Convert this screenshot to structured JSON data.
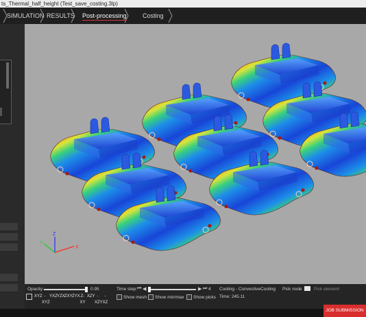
{
  "window": {
    "title": "ts_Thermal_half_height (Test_save_costing.3lp)"
  },
  "tabs": [
    {
      "label": "SIMULATION"
    },
    {
      "label": "RESULTS"
    },
    {
      "label": "Post-processing"
    },
    {
      "label": "Costing"
    }
  ],
  "active_tab": "Post-processing",
  "accent_color": "#d63a3a",
  "bottom": {
    "opacity_label": "Opacity:",
    "opacity_value": "0.95",
    "time_step_label": "Time step:",
    "time_step_value": "4",
    "result_name": "Cooling - ConvectiveCooling",
    "time": "Time: 245.11",
    "pick_node": "Pick node",
    "pick_element": "Pick element",
    "show_mesh": "Show mesh",
    "show_minmax": "Show min/max",
    "show_picks": "Show picks",
    "view_icons": [
      "XYZ",
      "-XYZ",
      "YXZ",
      "YZX",
      "ZXY",
      "ZYX",
      "Z-XY",
      "XZY",
      "-XZY",
      "-XZ",
      "YXZ",
      "XYZ"
    ]
  },
  "axes": {
    "x": "X",
    "y": "Y",
    "z": "Z"
  },
  "job_submission": "JOB SUBMISSION"
}
